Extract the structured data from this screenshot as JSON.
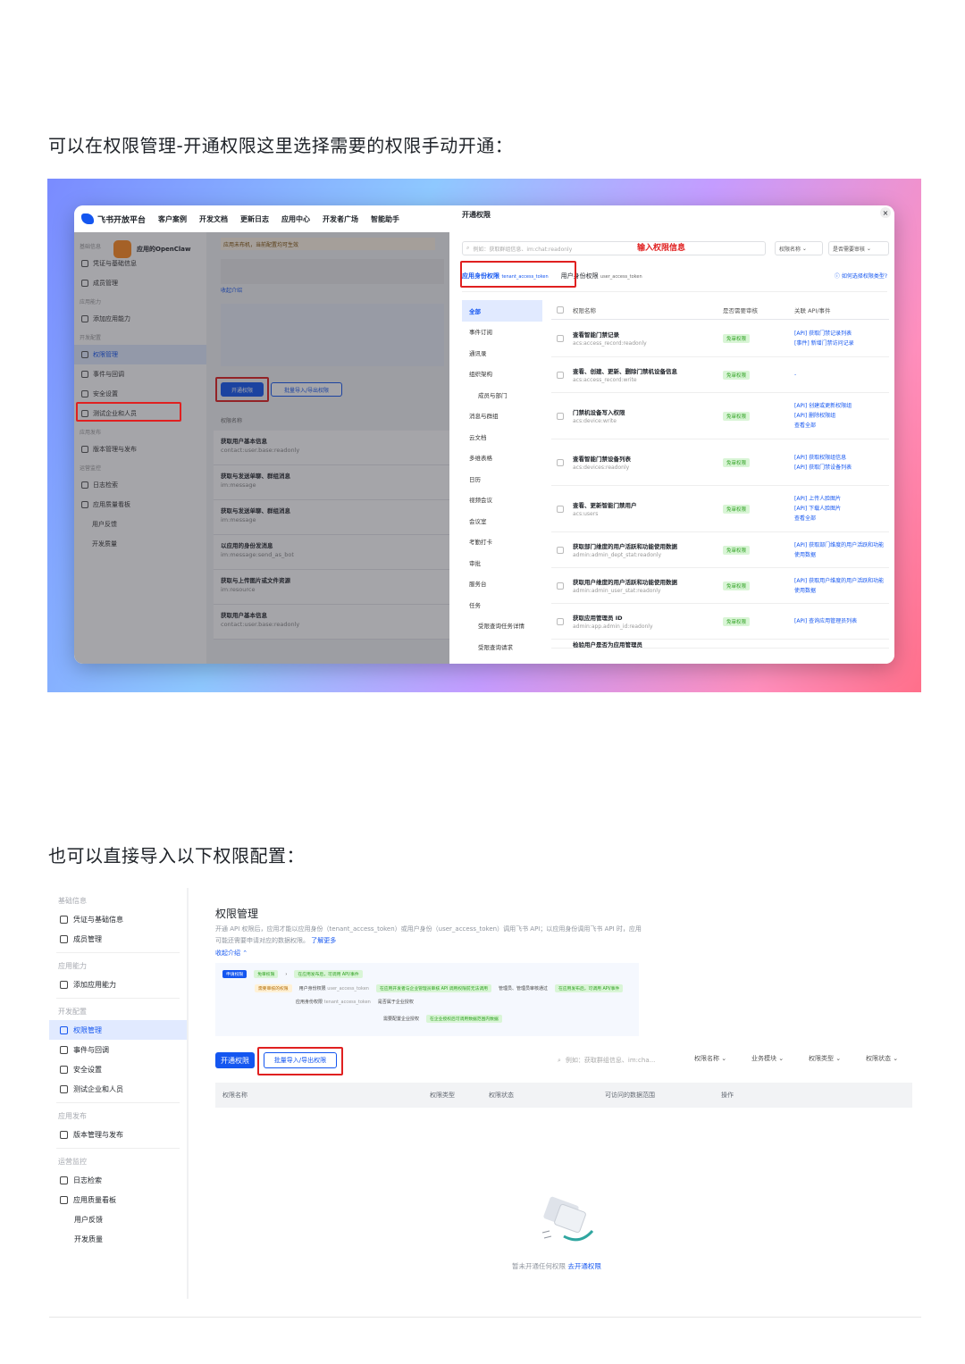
{
  "captions": {
    "first": "可以在权限管理-开通权限这里选择需要的权限手动开通：",
    "second": "也可以直接导入以下权限配置："
  },
  "shot1": {
    "brand": "飞书开放平台",
    "topnav": [
      "客户案例",
      "开发文档",
      "更新日志",
      "应用中心",
      "开发者广场",
      "智能助手"
    ],
    "app_name": "应用的OpenClaw",
    "notice": "应用未布机，当前配置均可生效",
    "sidebar": [
      {
        "type": "section",
        "label": "基础信息"
      },
      {
        "type": "item",
        "label": "凭证与基础信息"
      },
      {
        "type": "item",
        "label": "成员管理"
      },
      {
        "type": "section",
        "label": "应用能力"
      },
      {
        "type": "item",
        "label": "添加应用能力"
      },
      {
        "type": "section",
        "label": "开发配置"
      },
      {
        "type": "item",
        "label": "权限管理",
        "active": true
      },
      {
        "type": "item",
        "label": "事件与回调"
      },
      {
        "type": "item",
        "label": "安全设置"
      },
      {
        "type": "item",
        "label": "测试企业和人员"
      },
      {
        "type": "section",
        "label": "应用发布"
      },
      {
        "type": "item",
        "label": "版本管理与发布"
      },
      {
        "type": "section",
        "label": "运营监控"
      },
      {
        "type": "item",
        "label": "日志检索"
      },
      {
        "type": "item",
        "label": "应用质量看板"
      },
      {
        "type": "sub",
        "label": "用户反馈"
      },
      {
        "type": "sub",
        "label": "开发质量"
      }
    ],
    "intro_link": "收起介绍",
    "open_btn": "开通权限",
    "batch_btn": "批量导入/导出权限",
    "list_header": "权限名称",
    "bg_perms": [
      {
        "name": "获取用户基本信息",
        "code": "contact:user.base:readonly"
      },
      {
        "name": "获取与发送单聊、群组消息",
        "code": "im:message"
      },
      {
        "name": "获取与发送单聊、群组消息",
        "code": "im:message"
      },
      {
        "name": "以应用的身份发消息",
        "code": "im:message:send_as_bot"
      },
      {
        "name": "获取与上传图片或文件资源",
        "code": "im:resource"
      },
      {
        "name": "获取用户基本信息",
        "code": "contact:user.base:readonly"
      }
    ],
    "modal": {
      "title": "开通权限",
      "search_placeholder": "例如：获取群组信息、im:chat:readonly",
      "search_hint": "输入权限信息",
      "filter1": "权限名称",
      "filter2": "是否需要审核",
      "tab1": "应用身份权限",
      "tab1_token": "tenant_access_token",
      "tab2": "用户身份权限",
      "tab2_token": "user_access_token",
      "how_link": "如何选择权限类型?",
      "categories": [
        "全部",
        "事件订阅",
        "通讯录",
        "组织架构",
        "成员与部门",
        "消息与群组",
        "云文档",
        "多维表格",
        "日历",
        "视频会议",
        "会议室",
        "考勤打卡",
        "审批",
        "服务台",
        "任务",
        "受限查询任务详情",
        "受限查询请求"
      ],
      "columns": [
        "权限名称",
        "是否需要审核",
        "关联 API/事件"
      ],
      "rows": [
        {
          "name": "查看智能门禁记录",
          "code": "acs:access_record:readonly",
          "review": "免审权限",
          "apis": [
            "[API] 获取门禁记录列表",
            "[事件] 新增门禁访问记录"
          ]
        },
        {
          "name": "查看、创建、更新、删除门禁机设备信息",
          "code": "acs:access_record:write",
          "review": "免审权限",
          "apis": [
            "-"
          ]
        },
        {
          "name": "门禁机设备写入权限",
          "code": "acs:device:write",
          "review": "免审权限",
          "apis": [
            "[API] 创建或更新权限组",
            "[API] 删除权限组",
            "查看全部"
          ]
        },
        {
          "name": "查看智能门禁设备列表",
          "code": "acs:devices:readonly",
          "review": "免审权限",
          "apis": [
            "[API] 获取权限组信息",
            "[API] 获取门禁设备列表"
          ]
        },
        {
          "name": "查看、更新智能门禁用户",
          "code": "acs:users",
          "review": "免审权限",
          "apis": [
            "[API] 上传人脸图片",
            "[API] 下载人脸图片",
            "查看全部"
          ]
        },
        {
          "name": "获取部门维度的用户活跃和功能使用数据",
          "code": "admin:admin_dept_stat:readonly",
          "review": "免审权限",
          "apis": [
            "[API] 获取部门维度的用户活跃和功能使用数据"
          ]
        },
        {
          "name": "获取用户维度的用户活跃和功能使用数据",
          "code": "admin:admin_user_stat:readonly",
          "review": "免审权限",
          "apis": [
            "[API] 获取用户维度的用户活跃和功能使用数据"
          ]
        },
        {
          "name": "获取应用管理员 ID",
          "code": "admin:app.admin_id:readonly",
          "review": "免审权限",
          "apis": [
            "[API] 查询应用管理员列表"
          ]
        }
      ],
      "last_row_partial": "检验用户是否为应用管理员"
    }
  },
  "shot2": {
    "sidebar": [
      {
        "type": "section",
        "label": "基础信息"
      },
      {
        "type": "item",
        "label": "凭证与基础信息"
      },
      {
        "type": "item",
        "label": "成员管理"
      },
      {
        "type": "divider"
      },
      {
        "type": "section",
        "label": "应用能力"
      },
      {
        "type": "item",
        "label": "添加应用能力"
      },
      {
        "type": "divider"
      },
      {
        "type": "section",
        "label": "开发配置"
      },
      {
        "type": "item",
        "label": "权限管理",
        "active": true
      },
      {
        "type": "item",
        "label": "事件与回调"
      },
      {
        "type": "item",
        "label": "安全设置"
      },
      {
        "type": "item",
        "label": "测试企业和人员"
      },
      {
        "type": "divider"
      },
      {
        "type": "section",
        "label": "应用发布"
      },
      {
        "type": "item",
        "label": "版本管理与发布"
      },
      {
        "type": "divider"
      },
      {
        "type": "section",
        "label": "运营监控"
      },
      {
        "type": "item",
        "label": "日志检索"
      },
      {
        "type": "item",
        "label": "应用质量看板"
      },
      {
        "type": "sub",
        "label": "用户反馈"
      },
      {
        "type": "sub",
        "label": "开发质量"
      }
    ],
    "title": "权限管理",
    "desc": "开通 API 权限后，应用才能以应用身份（tenant_access_token）或用户身份（user_access_token）调用飞书 API；以应用身份调用飞书 API 时，应用可能还需要申请对应的数据权限。",
    "learn_more": "了解更多",
    "collapse": "收起介绍",
    "flow": {
      "start": "申请权限",
      "free": "免审权限",
      "step_ok": "在应用发布后，可调用 API/事件",
      "user_token": "用户身份权限",
      "user_token_code": "user_access_token",
      "app_token": "应用身份权限",
      "app_token_code": "tenant_access_token",
      "need_review": "需要审核的权限",
      "review1": "在应用开发者与企业管理员审核 API 调用权限前无法调用",
      "review2": "管理员、管理员审核通过",
      "review3": "在应用发布后，可调用 API/事件",
      "bind_enterprise": "是否属于企业授权",
      "must_scope": "需要配置企业授权",
      "scope_ok": "在企业授权后可调用数据范围内数据"
    },
    "open_btn": "开通权限",
    "batch_btn": "批量导入/导出权限",
    "search_placeholder": "例如：获取群组信息、im:cha...",
    "filters": [
      "权限名称",
      "业务模块",
      "权限类型",
      "权限状态"
    ],
    "columns": [
      "权限名称",
      "权限类型",
      "权限状态",
      "可访问的数据范围",
      "操作"
    ],
    "empty_text": "暂未开通任何权限",
    "empty_link": "去开通权限"
  },
  "colors": {
    "brand_blue": "#1456f0",
    "highlight_red": "#e02020",
    "tag_green": "#2ea121"
  }
}
